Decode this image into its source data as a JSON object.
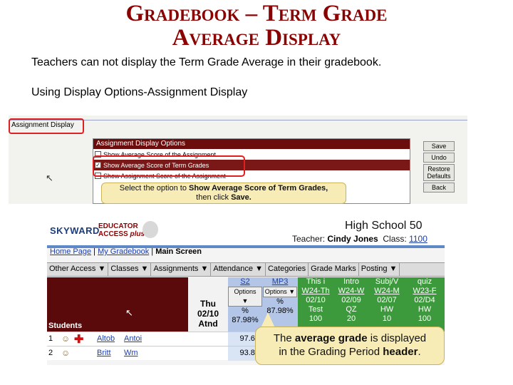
{
  "slide": {
    "title_line1": "Gradebook – Term Grade",
    "title_line2": "Average Display",
    "line1": "Teachers can not display the Term Grade Average in their gradebook.",
    "line2": "Using Display Options-Assignment Display"
  },
  "assignment_display": {
    "tab_label": "Assignment Display",
    "panel_title": "Assignment Display Options",
    "options": [
      {
        "label": "Show Average Score of the Assignment",
        "checked": false
      },
      {
        "label": "Show Average Score of Term Grades",
        "checked": true
      },
      {
        "label": "Show Assignment Score of the Assignment",
        "checked": false
      }
    ],
    "buttons": {
      "save": "Save",
      "undo": "Undo",
      "restore_line1": "Restore",
      "restore_line2": "Defaults",
      "back": "Back"
    },
    "callout_text1": "Select the option to ",
    "callout_bold": "Show Average Score of Term Grades,",
    "callout_text2": "then click ",
    "callout_bold2": "Save."
  },
  "gradebook": {
    "brand": "SKYWARD",
    "brand_sub1": "EDUCATOR",
    "brand_sub2": "ACCESS",
    "brand_sub3": "plus",
    "school": "High School 50",
    "teacher_label": "Teacher: ",
    "teacher_name": "Cindy Jones",
    "class_label": "Class: ",
    "class_value": "1100",
    "breadcrumb": {
      "home": "Home Page",
      "sep1": " | ",
      "gradebook": "My Gradebook",
      "sep2": " | ",
      "current": "Main Screen"
    },
    "menu": [
      "Other Access ▼",
      "Classes ▼",
      "Assignments ▼",
      "Attendance ▼",
      "Categories",
      "Grade Marks",
      "Posting ▼"
    ],
    "students_label": "Students",
    "date_col": {
      "line1": "Thu",
      "line2": "02/10",
      "line3": "Atnd"
    },
    "s2": {
      "name": "S2",
      "options": "Options ▼",
      "pct": "%",
      "avg": "87.98%"
    },
    "mp3": {
      "name": "MP3",
      "options": "Options ▼",
      "pct": "%",
      "avg": "87.98%"
    },
    "assignments": [
      {
        "name": "This i",
        "code": "W24-Th",
        "date": "02/10",
        "type": "Test",
        "pts": "100"
      },
      {
        "name": "Intro",
        "code": "W24-W",
        "date": "02/09",
        "type": "QZ",
        "pts": "20"
      },
      {
        "name": "Subj/V",
        "code": "W24-M",
        "date": "02/07",
        "type": "HW",
        "pts": "10"
      },
      {
        "name": "quiz",
        "code": "W23-F",
        "date": "02/D4",
        "type": "HW",
        "pts": "100"
      }
    ],
    "rows": [
      {
        "num": "1",
        "last": "Altob",
        "first": "Antoi",
        "score": "97.63"
      },
      {
        "num": "2",
        "last": "Britt",
        "first": "Wm",
        "score": "93.85"
      }
    ],
    "callout_a": "The ",
    "callout_bold1": "average grade",
    "callout_b": " is displayed",
    "callout_c": "in the Grading Period ",
    "callout_bold2": "header",
    "callout_d": "."
  }
}
